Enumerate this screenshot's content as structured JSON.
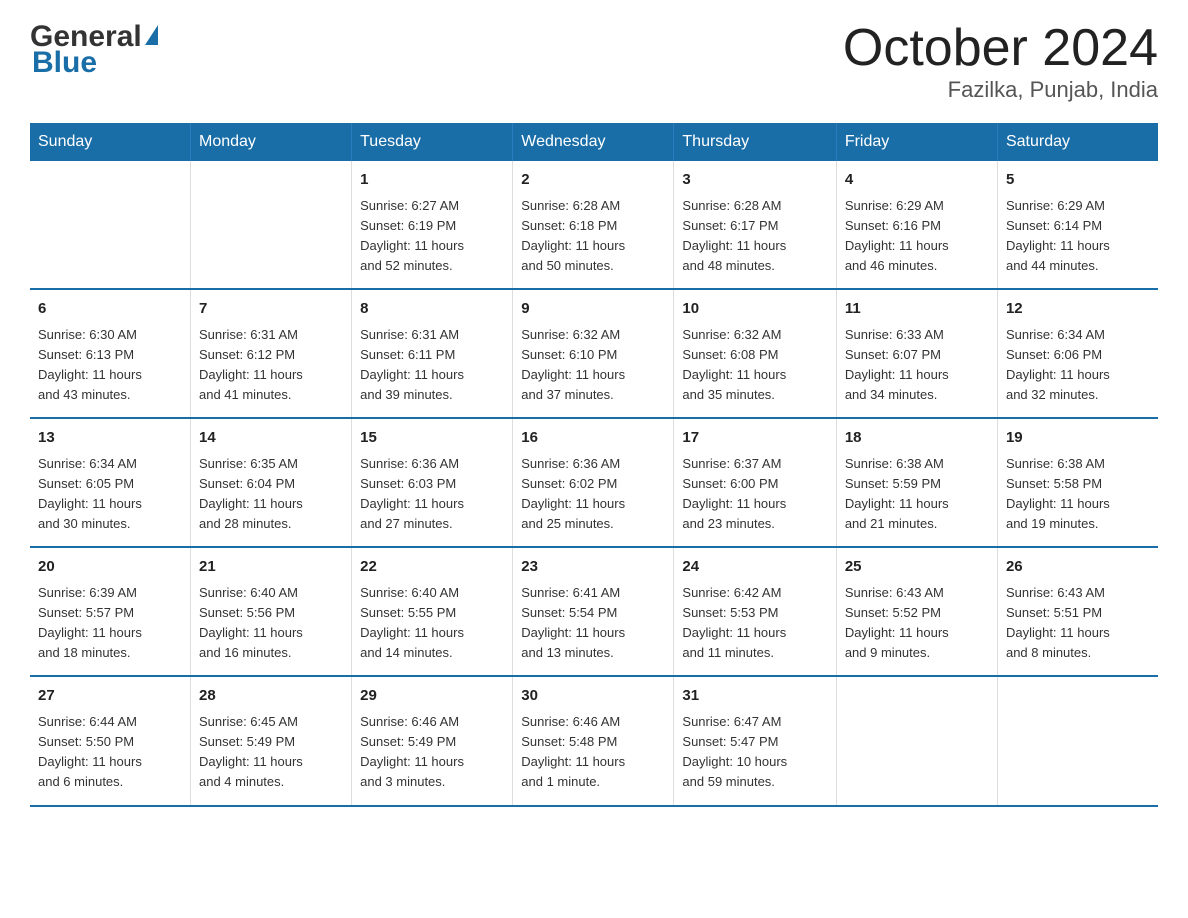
{
  "logo": {
    "general": "General",
    "blue": "Blue",
    "triangle_color": "#1a6ea8"
  },
  "title": {
    "month_year": "October 2024",
    "location": "Fazilka, Punjab, India"
  },
  "header_days": [
    "Sunday",
    "Monday",
    "Tuesday",
    "Wednesday",
    "Thursday",
    "Friday",
    "Saturday"
  ],
  "weeks": [
    [
      {
        "day": "",
        "info": ""
      },
      {
        "day": "",
        "info": ""
      },
      {
        "day": "1",
        "info": "Sunrise: 6:27 AM\nSunset: 6:19 PM\nDaylight: 11 hours\nand 52 minutes."
      },
      {
        "day": "2",
        "info": "Sunrise: 6:28 AM\nSunset: 6:18 PM\nDaylight: 11 hours\nand 50 minutes."
      },
      {
        "day": "3",
        "info": "Sunrise: 6:28 AM\nSunset: 6:17 PM\nDaylight: 11 hours\nand 48 minutes."
      },
      {
        "day": "4",
        "info": "Sunrise: 6:29 AM\nSunset: 6:16 PM\nDaylight: 11 hours\nand 46 minutes."
      },
      {
        "day": "5",
        "info": "Sunrise: 6:29 AM\nSunset: 6:14 PM\nDaylight: 11 hours\nand 44 minutes."
      }
    ],
    [
      {
        "day": "6",
        "info": "Sunrise: 6:30 AM\nSunset: 6:13 PM\nDaylight: 11 hours\nand 43 minutes."
      },
      {
        "day": "7",
        "info": "Sunrise: 6:31 AM\nSunset: 6:12 PM\nDaylight: 11 hours\nand 41 minutes."
      },
      {
        "day": "8",
        "info": "Sunrise: 6:31 AM\nSunset: 6:11 PM\nDaylight: 11 hours\nand 39 minutes."
      },
      {
        "day": "9",
        "info": "Sunrise: 6:32 AM\nSunset: 6:10 PM\nDaylight: 11 hours\nand 37 minutes."
      },
      {
        "day": "10",
        "info": "Sunrise: 6:32 AM\nSunset: 6:08 PM\nDaylight: 11 hours\nand 35 minutes."
      },
      {
        "day": "11",
        "info": "Sunrise: 6:33 AM\nSunset: 6:07 PM\nDaylight: 11 hours\nand 34 minutes."
      },
      {
        "day": "12",
        "info": "Sunrise: 6:34 AM\nSunset: 6:06 PM\nDaylight: 11 hours\nand 32 minutes."
      }
    ],
    [
      {
        "day": "13",
        "info": "Sunrise: 6:34 AM\nSunset: 6:05 PM\nDaylight: 11 hours\nand 30 minutes."
      },
      {
        "day": "14",
        "info": "Sunrise: 6:35 AM\nSunset: 6:04 PM\nDaylight: 11 hours\nand 28 minutes."
      },
      {
        "day": "15",
        "info": "Sunrise: 6:36 AM\nSunset: 6:03 PM\nDaylight: 11 hours\nand 27 minutes."
      },
      {
        "day": "16",
        "info": "Sunrise: 6:36 AM\nSunset: 6:02 PM\nDaylight: 11 hours\nand 25 minutes."
      },
      {
        "day": "17",
        "info": "Sunrise: 6:37 AM\nSunset: 6:00 PM\nDaylight: 11 hours\nand 23 minutes."
      },
      {
        "day": "18",
        "info": "Sunrise: 6:38 AM\nSunset: 5:59 PM\nDaylight: 11 hours\nand 21 minutes."
      },
      {
        "day": "19",
        "info": "Sunrise: 6:38 AM\nSunset: 5:58 PM\nDaylight: 11 hours\nand 19 minutes."
      }
    ],
    [
      {
        "day": "20",
        "info": "Sunrise: 6:39 AM\nSunset: 5:57 PM\nDaylight: 11 hours\nand 18 minutes."
      },
      {
        "day": "21",
        "info": "Sunrise: 6:40 AM\nSunset: 5:56 PM\nDaylight: 11 hours\nand 16 minutes."
      },
      {
        "day": "22",
        "info": "Sunrise: 6:40 AM\nSunset: 5:55 PM\nDaylight: 11 hours\nand 14 minutes."
      },
      {
        "day": "23",
        "info": "Sunrise: 6:41 AM\nSunset: 5:54 PM\nDaylight: 11 hours\nand 13 minutes."
      },
      {
        "day": "24",
        "info": "Sunrise: 6:42 AM\nSunset: 5:53 PM\nDaylight: 11 hours\nand 11 minutes."
      },
      {
        "day": "25",
        "info": "Sunrise: 6:43 AM\nSunset: 5:52 PM\nDaylight: 11 hours\nand 9 minutes."
      },
      {
        "day": "26",
        "info": "Sunrise: 6:43 AM\nSunset: 5:51 PM\nDaylight: 11 hours\nand 8 minutes."
      }
    ],
    [
      {
        "day": "27",
        "info": "Sunrise: 6:44 AM\nSunset: 5:50 PM\nDaylight: 11 hours\nand 6 minutes."
      },
      {
        "day": "28",
        "info": "Sunrise: 6:45 AM\nSunset: 5:49 PM\nDaylight: 11 hours\nand 4 minutes."
      },
      {
        "day": "29",
        "info": "Sunrise: 6:46 AM\nSunset: 5:49 PM\nDaylight: 11 hours\nand 3 minutes."
      },
      {
        "day": "30",
        "info": "Sunrise: 6:46 AM\nSunset: 5:48 PM\nDaylight: 11 hours\nand 1 minute."
      },
      {
        "day": "31",
        "info": "Sunrise: 6:47 AM\nSunset: 5:47 PM\nDaylight: 10 hours\nand 59 minutes."
      },
      {
        "day": "",
        "info": ""
      },
      {
        "day": "",
        "info": ""
      }
    ]
  ]
}
